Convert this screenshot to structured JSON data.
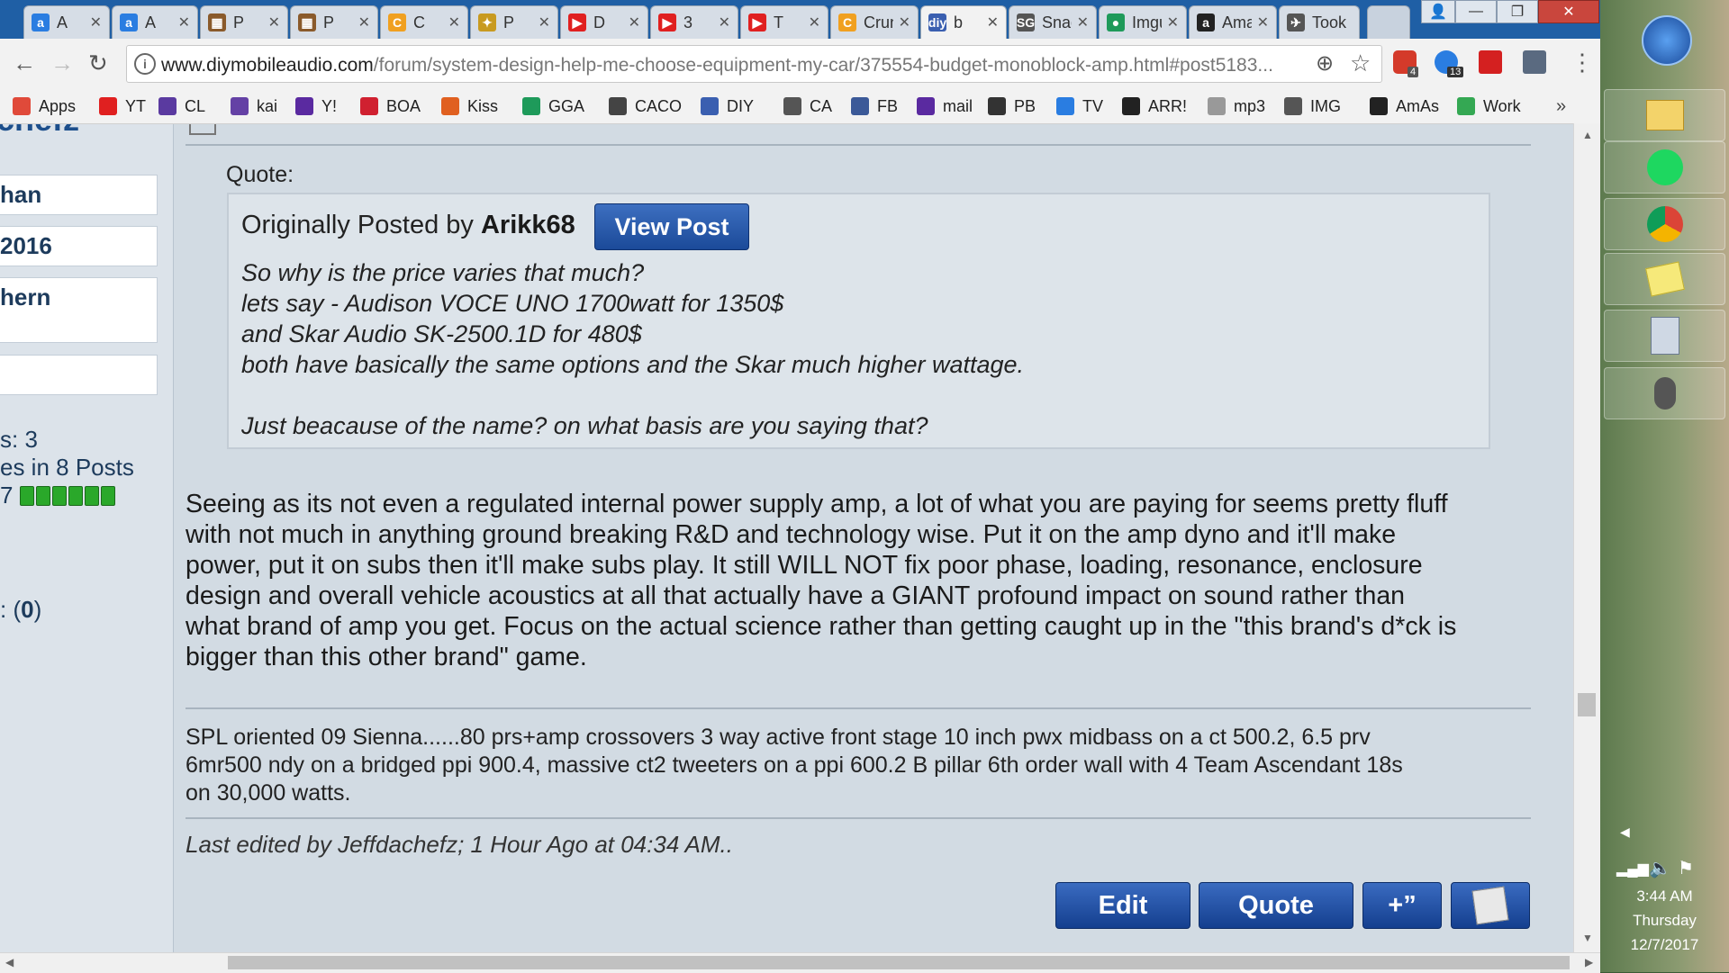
{
  "tabs": [
    {
      "title": "A",
      "fav": "a",
      "color": "#2a7de1"
    },
    {
      "title": "A",
      "fav": "a",
      "color": "#2a7de1"
    },
    {
      "title": "P",
      "fav": "▦",
      "color": "#8a5a2b"
    },
    {
      "title": "P",
      "fav": "▦",
      "color": "#8a5a2b"
    },
    {
      "title": "C",
      "fav": "C",
      "color": "#f0a020"
    },
    {
      "title": "P",
      "fav": "✦",
      "color": "#c89a20"
    },
    {
      "title": "D",
      "fav": "▶",
      "color": "#e02020"
    },
    {
      "title": "3",
      "fav": "▶",
      "color": "#e02020"
    },
    {
      "title": "T",
      "fav": "▶",
      "color": "#e02020"
    },
    {
      "title": "Crun",
      "fav": "C",
      "color": "#f0a020"
    },
    {
      "title": "b",
      "fav": "diy",
      "color": "#3a5fb0"
    },
    {
      "title": "Snag",
      "fav": "SG",
      "color": "#555555"
    },
    {
      "title": "Imgu",
      "fav": "●",
      "color": "#1e9a5a"
    },
    {
      "title": "Ama",
      "fav": "a",
      "color": "#222222"
    },
    {
      "title": "Took",
      "fav": "✈",
      "color": "#555555"
    }
  ],
  "url": {
    "domain": "www.diymobileaudio.com",
    "path": "/forum/system-design-help-me-choose-equipment-my-car/375554-budget-monoblock-amp.html#post5183..."
  },
  "extension_badges": {
    "a": "4",
    "b": "13"
  },
  "bookmarks": [
    {
      "label": "Apps",
      "icon": "apps-icon",
      "color": "#e04a3a"
    },
    {
      "label": "YT",
      "icon": "youtube-icon",
      "color": "#e02020"
    },
    {
      "label": "CL",
      "icon": "peace-icon",
      "color": "#5a3aa0"
    },
    {
      "label": "kai",
      "icon": "twitch-icon",
      "color": "#6441a5"
    },
    {
      "label": "Y!",
      "icon": "mail-icon",
      "color": "#5a2aa0"
    },
    {
      "label": "BOA",
      "icon": "boa-icon",
      "color": "#d02030"
    },
    {
      "label": "Kiss",
      "icon": "kiss-icon",
      "color": "#e06020"
    },
    {
      "label": "GGA",
      "icon": "gga-icon",
      "color": "#1e9a5a"
    },
    {
      "label": "CACO",
      "icon": "caco-icon",
      "color": "#444444"
    },
    {
      "label": "DIY",
      "icon": "diy-icon",
      "color": "#3a5fb0"
    },
    {
      "label": "CA",
      "icon": "ca-icon",
      "color": "#555555"
    },
    {
      "label": "FB",
      "icon": "facebook-icon",
      "color": "#3b5998"
    },
    {
      "label": "mail",
      "icon": "mail-icon",
      "color": "#5a2aa0"
    },
    {
      "label": "PB",
      "icon": "camera-icon",
      "color": "#333333"
    },
    {
      "label": "TV",
      "icon": "tv-icon",
      "color": "#2a7de1"
    },
    {
      "label": "ARR!",
      "icon": "pirate-icon",
      "color": "#222222"
    },
    {
      "label": "mp3",
      "icon": "mp3-icon",
      "color": "#999999"
    },
    {
      "label": "IMG",
      "icon": "sg-icon",
      "color": "#555555"
    },
    {
      "label": "AmAs",
      "icon": "amazon-icon",
      "color": "#222222"
    },
    {
      "label": "Work",
      "icon": "maps-icon",
      "color": "#34a853"
    }
  ],
  "sidebar": {
    "name_fragment": "chefz",
    "box1": "han",
    "box2": " 2016",
    "box3": "hern",
    "stat1": "s: 3",
    "stat2": "es in 8 Posts",
    "stat3": "7",
    "rep_fragment": ": (",
    "rep_value": "0",
    "rep_close": ")"
  },
  "quote": {
    "label": "Quote:",
    "orig_prefix": "Originally Posted by ",
    "author": "Arikk68",
    "view_post": "View Post",
    "lines": [
      "So why is the price varies that much?",
      "lets say - Audison VOCE UNO 1700watt for 1350$",
      "and Skar Audio SK-2500.1D for 480$",
      "both have basically the same options and the Skar much higher wattage.",
      "",
      "Just beacause of the name? on what basis are you saying that?"
    ]
  },
  "post_body": [
    "Seeing as its not even a regulated internal power supply amp, a lot of what you are paying for seems pretty fluff",
    "with not much in anything ground breaking R&D and technology wise. Put it on the amp dyno and it'll make",
    "power, put it on subs then it'll make subs play. It still WILL NOT fix poor phase, loading, resonance, enclosure",
    "design and overall vehicle acoustics at all that actually have a GIANT profound impact on sound rather than",
    "what brand of amp you get. Focus on the actual science rather than getting caught up in the \"this brand's d*ck is",
    "bigger than this other brand\" game."
  ],
  "signature": [
    "SPL oriented 09 Sienna......80 prs+amp crossovers 3 way active front stage 10 inch pwx midbass on a ct 500.2, 6.5 prv",
    "6mr500 ndy on a bridged ppi 900.4, massive ct2 tweeters on a ppi 600.2 B pillar 6th order wall with 4 Team Ascendant 18s",
    "on 30,000 watts."
  ],
  "edited": "Last edited by Jeffdachefz; 1 Hour Ago at 04:34 AM..",
  "buttons": {
    "edit": "Edit",
    "quote": "Quote",
    "plus": "+”"
  },
  "clock": {
    "time": "3:44 AM",
    "day": "Thursday",
    "date": "12/7/2017"
  },
  "bookmarks_more": "»"
}
